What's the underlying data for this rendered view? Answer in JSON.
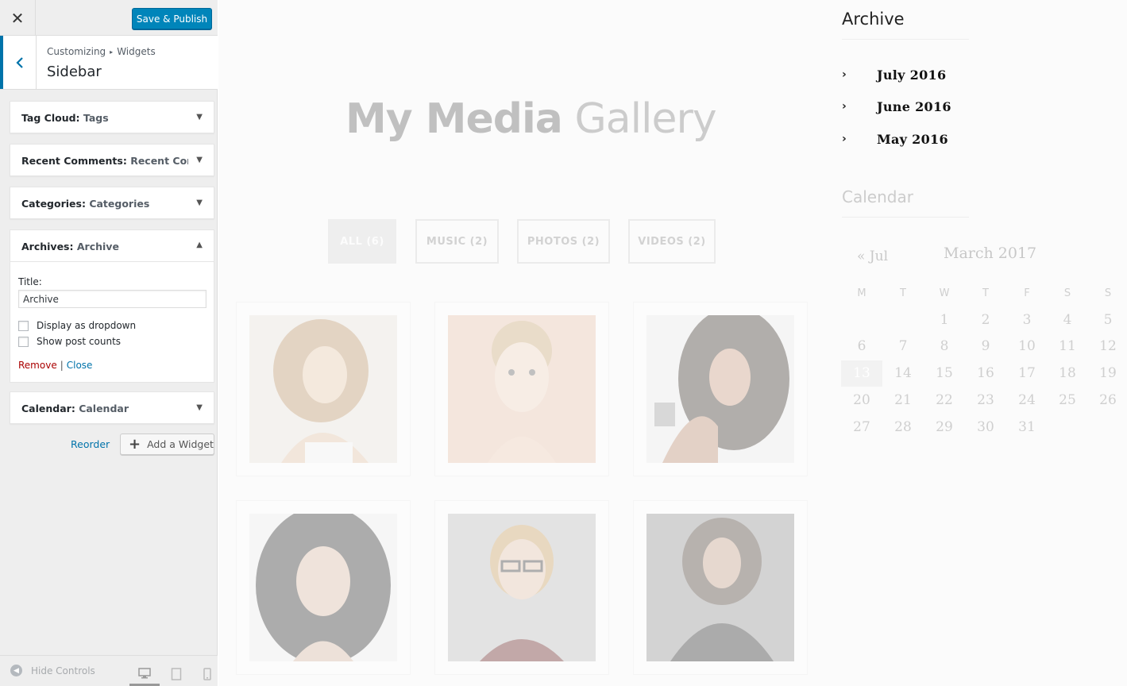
{
  "customizer": {
    "close_glyph": "✕",
    "save_label": "Save & Publish",
    "breadcrumb": {
      "root": "Customizing",
      "separator": "▸",
      "section": "Widgets"
    },
    "panel_title": "Sidebar",
    "widgets": [
      {
        "type": "Tag Cloud",
        "instance": "Tags",
        "arrow": "▼"
      },
      {
        "type": "Recent Comments",
        "instance": "Recent Com...",
        "arrow": "▼"
      },
      {
        "type": "Categories",
        "instance": "Categories",
        "arrow": "▼"
      },
      {
        "type": "Archives",
        "instance": "Archive",
        "arrow": "▲"
      },
      {
        "type": "Calendar",
        "instance": "Calendar",
        "arrow": "▼"
      }
    ],
    "archives_form": {
      "title_label": "Title:",
      "title_value": "Archive",
      "dropdown_label": "Display as dropdown",
      "dropdown_checked": false,
      "counts_label": "Show post counts",
      "counts_checked": false,
      "remove_label": "Remove",
      "separator": "|",
      "close_label": "Close"
    },
    "reorder_label": "Reorder",
    "add_widget_label": "Add a Widget",
    "add_widget_glyph": "+",
    "footer": {
      "hide_controls_label": "Hide Controls",
      "devices": [
        {
          "icon": "desktop-icon",
          "active": true
        },
        {
          "icon": "tablet-icon",
          "active": false
        },
        {
          "icon": "mobile-icon",
          "active": false
        }
      ]
    }
  },
  "preview": {
    "site_title_bold": "My Media",
    "site_title_light": "Gallery",
    "filters": [
      {
        "label": "ALL (6)",
        "active": true
      },
      {
        "label": "MUSIC (2)",
        "active": false
      },
      {
        "label": "PHOTOS (2)",
        "active": false
      },
      {
        "label": "VIDEOS (2)",
        "active": false
      }
    ],
    "gallery_tiles": 6,
    "archive_widget": {
      "title": "Archive",
      "items": [
        "July 2016",
        "June 2016",
        "May 2016"
      ],
      "chevron": "›"
    },
    "calendar_widget": {
      "title": "Calendar",
      "prev_link": "« Jul",
      "month": "March 2017",
      "weekday_headers": [
        "M",
        "T",
        "W",
        "T",
        "F",
        "S",
        "S"
      ],
      "weeks": [
        [
          "",
          "",
          "1",
          "2",
          "3",
          "4",
          "5"
        ],
        [
          "6",
          "7",
          "8",
          "9",
          "10",
          "11",
          "12"
        ],
        [
          "13",
          "14",
          "15",
          "16",
          "17",
          "18",
          "19"
        ],
        [
          "20",
          "21",
          "22",
          "23",
          "24",
          "25",
          "26"
        ],
        [
          "27",
          "28",
          "29",
          "30",
          "31",
          "",
          ""
        ]
      ],
      "today": "13"
    }
  },
  "colors": {
    "primary_button": "#0085ba",
    "link": "#0073aa",
    "remove_link": "#aa0000",
    "sidebar_bg": "#eeeeee"
  }
}
